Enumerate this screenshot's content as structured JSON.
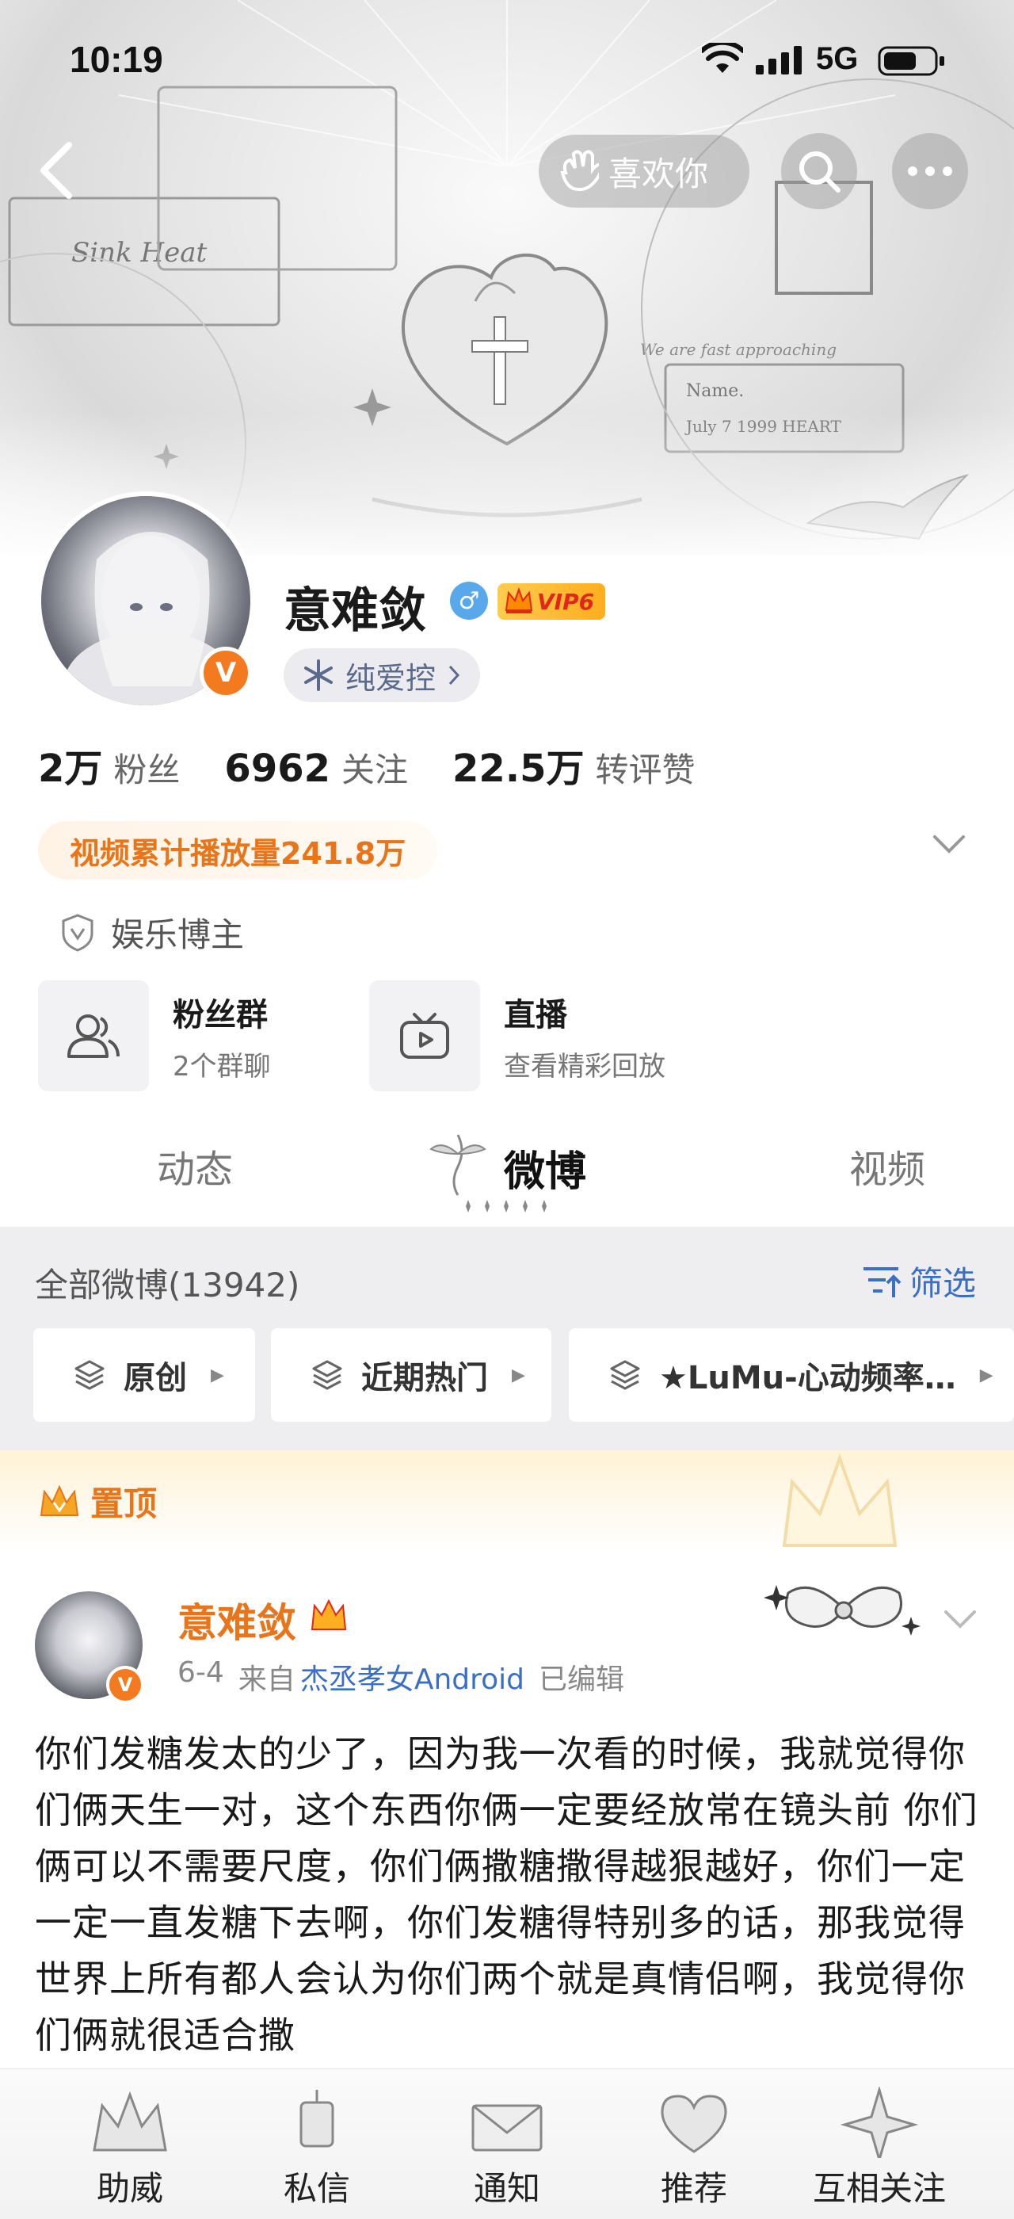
{
  "status_bar": {
    "time": "10:19",
    "network": "5G"
  },
  "top_nav": {
    "like_label": "喜欢你"
  },
  "profile": {
    "username": "意难敛",
    "gender": "♂",
    "verified_mark": "V",
    "vip_label": "VIP6",
    "tag_label": "纯爱控",
    "stats": [
      {
        "num": "2万",
        "label": "粉丝"
      },
      {
        "num": "6962",
        "label": "关注"
      },
      {
        "num": "22.5万",
        "label": "转评赞"
      }
    ],
    "video_plays": "视频累计播放量241.8万",
    "role": "娱乐博主"
  },
  "cards": [
    {
      "title": "粉丝群",
      "sub": "2个群聊"
    },
    {
      "title": "直播",
      "sub": "查看精彩回放"
    }
  ],
  "tabs": [
    {
      "label": "动态"
    },
    {
      "label": "微博",
      "active": true
    },
    {
      "label": "视频"
    }
  ],
  "feed_header": {
    "all_posts": "全部微博(13942)",
    "filter_label": "筛选"
  },
  "chips": [
    {
      "label": "原创"
    },
    {
      "label": "近期热门"
    },
    {
      "label": "★LuMu-心动频率…"
    }
  ],
  "pinned": {
    "label": "置顶"
  },
  "post": {
    "author": "意难敛",
    "date": "6-4",
    "from": "来自",
    "source": "杰丞孝女Android",
    "edited": "已编辑",
    "body": "你们发糖发太的少了，因为我一次看的时候，我就觉得你们俩天生一对，这个东西你俩一定要经放常在镜头前 你们俩可以不需要尺度，你们俩撒糖撒得越狠越好，你们一定一定一直发糖下去啊，你们发糖得特别多的话，那我觉得世界上所有都人会认为你们两个就是真情侣啊，我觉得你们俩就很适合撒"
  },
  "bottom_nav": [
    {
      "label": "助威"
    },
    {
      "label": "私信"
    },
    {
      "label": "通知"
    },
    {
      "label": "推荐"
    },
    {
      "label": "互相关注"
    }
  ],
  "colors": {
    "accent_orange": "#e8751a",
    "link_blue": "#3b6fc2",
    "vip_gold": "#ffb020",
    "verified_orange": "#f47a1f"
  }
}
